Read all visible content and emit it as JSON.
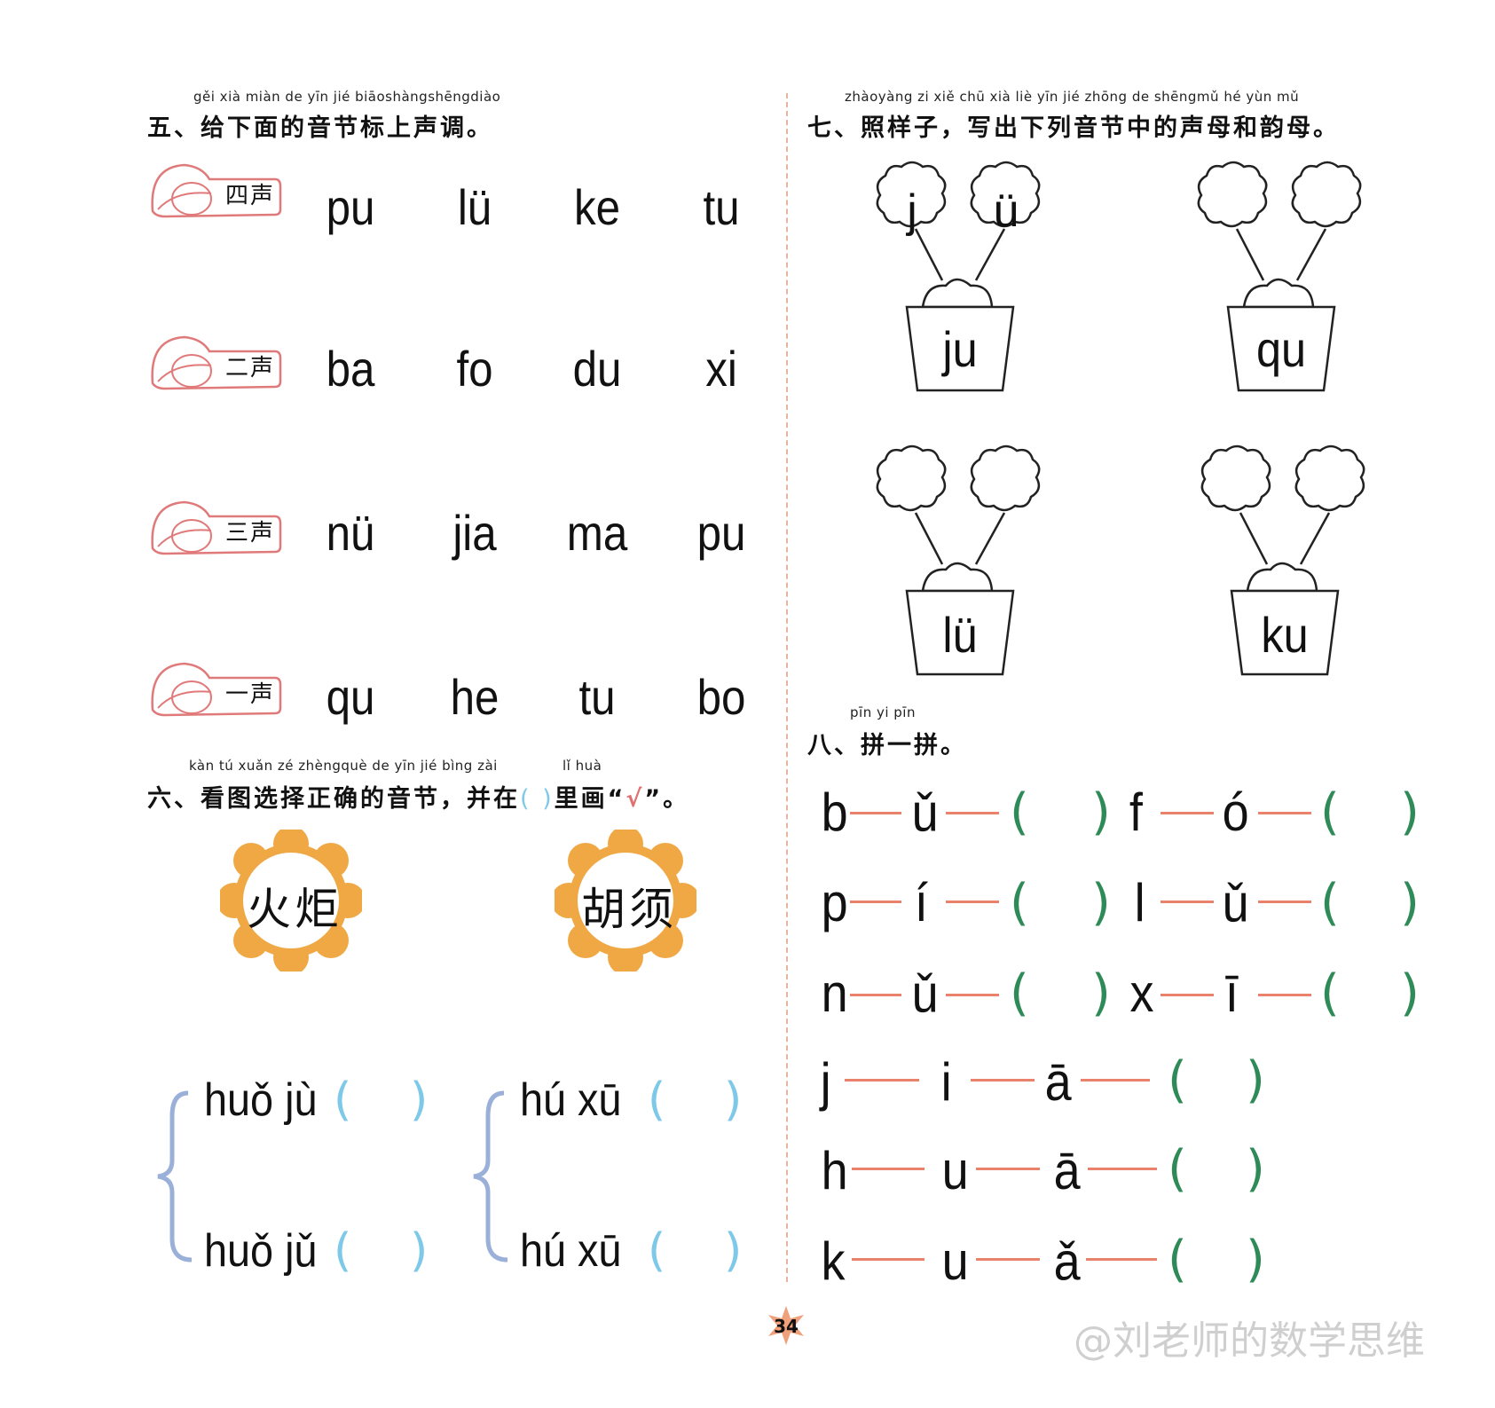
{
  "section5": {
    "pinyin": "gěi xià miàn de  yīn  jié  biāoshàngshēngdiào",
    "title": "五、给下面的音节标上声调。",
    "rows": [
      {
        "tone": "四声",
        "syllables": [
          "pu",
          "lü",
          "ke",
          "tu"
        ]
      },
      {
        "tone": "二声",
        "syllables": [
          "ba",
          "fo",
          "du",
          "xi"
        ]
      },
      {
        "tone": "三声",
        "syllables": [
          "nü",
          "jia",
          "ma",
          "pu"
        ]
      },
      {
        "tone": "一声",
        "syllables": [
          "qu",
          "he",
          "tu",
          "bo"
        ]
      }
    ]
  },
  "section6": {
    "pinyin_a": "kàn  tú  xuǎn  zé  zhèngquè  de  yīn  jié   bìng zài",
    "pinyin_b": "lǐ  huà",
    "title_a": "六、看图选择正确的音节，并在",
    "title_paren": "(     )",
    "title_b": "里画",
    "title_quote_open": "“",
    "title_check": "√",
    "title_quote_close": "”。",
    "pictures": [
      {
        "word": "火炬",
        "options": [
          "huǒ jù",
          "huǒ jǔ"
        ]
      },
      {
        "word": "胡须",
        "options": [
          "hú  xū",
          "hú  xū"
        ]
      }
    ],
    "paren_open": "(",
    "paren_close": ")"
  },
  "section7": {
    "pinyin": "zhàoyàng  zi     xiě  chū  xià  liè  yīn  jié zhōng de shēngmǔ  hé  yùn  mǔ",
    "title": "七、照样子，写出下列音节中的声母和韵母。",
    "example": {
      "left": "j",
      "right": "ü"
    },
    "pots": [
      "ju",
      "qu",
      "lü",
      "ku"
    ]
  },
  "section8": {
    "pinyin": "pīn  yi  pīn",
    "title": "八、拼一拼。",
    "pairs": [
      [
        "b",
        "ǔ",
        "f",
        "ó"
      ],
      [
        "p",
        "í",
        "l",
        "ǔ"
      ],
      [
        "n",
        "ǔ",
        "x",
        "ī"
      ]
    ],
    "triples": [
      [
        "j",
        "i",
        "ā"
      ],
      [
        "h",
        "u",
        "ā"
      ],
      [
        "k",
        "u",
        "ǎ"
      ]
    ],
    "paren_open": "(",
    "paren_close": ")"
  },
  "page_number": "34",
  "watermark": "@刘老师的数学思维",
  "colors": {
    "accent": "#e8826a",
    "paren_blue": "#7ec8e8",
    "paren_green": "#2e8b57",
    "flower": "#f0a845",
    "leaf": "#e07a7a"
  }
}
